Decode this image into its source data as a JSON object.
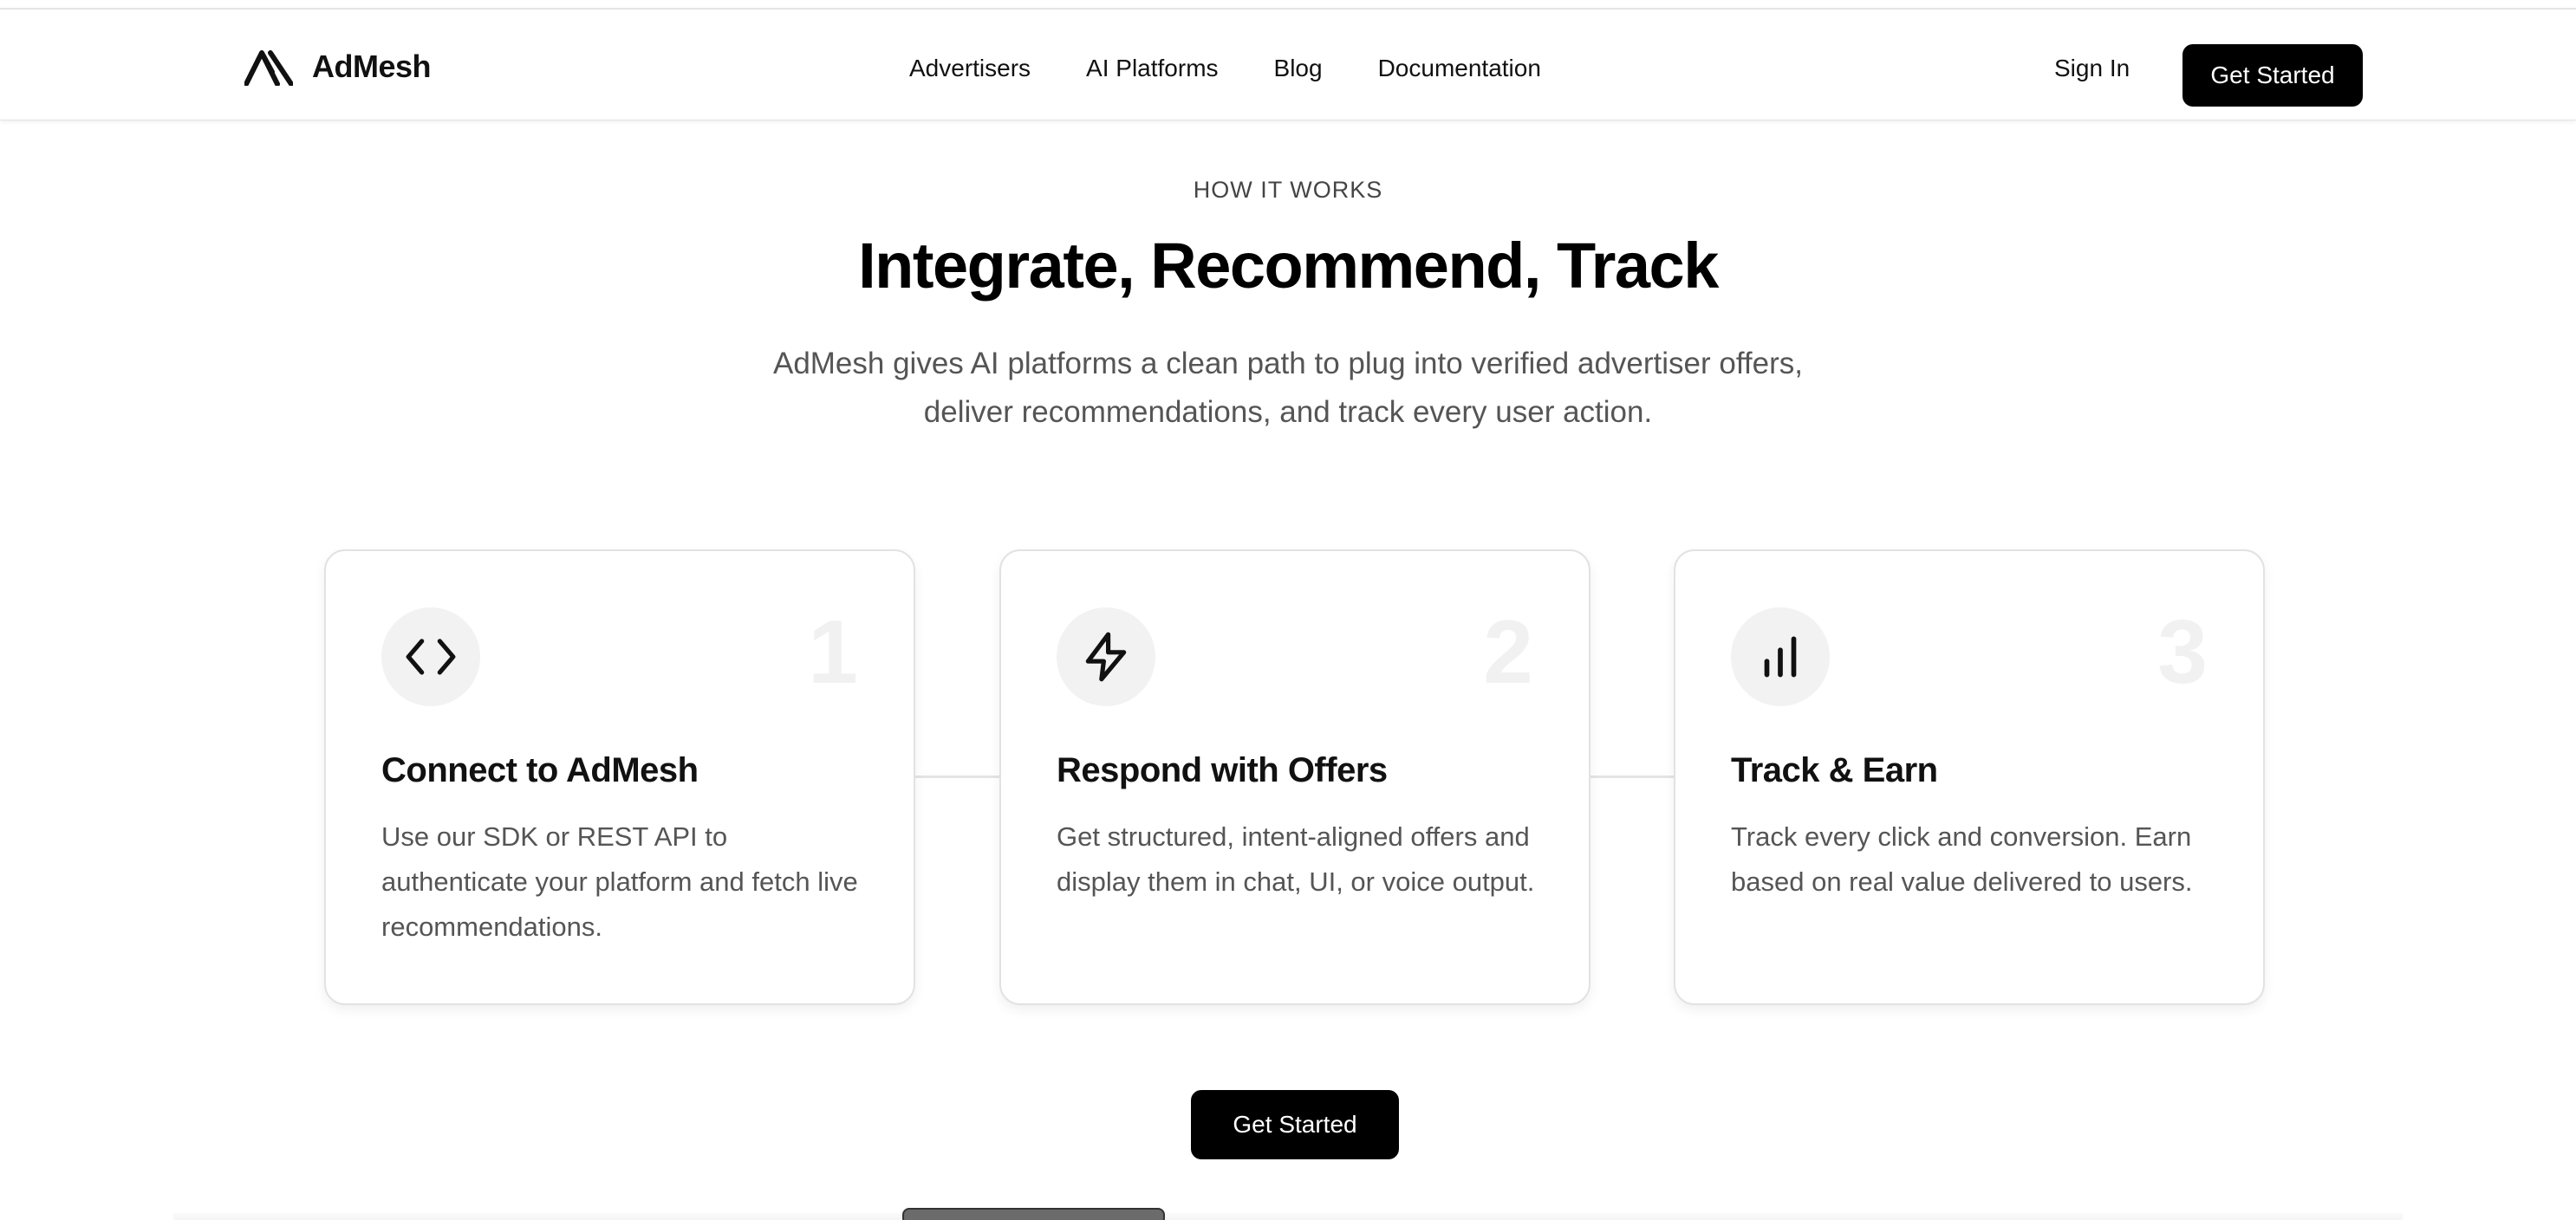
{
  "brand": {
    "name": "AdMesh"
  },
  "nav": {
    "links": [
      "Advertisers",
      "AI Platforms",
      "Blog",
      "Documentation"
    ],
    "sign_in": "Sign In",
    "cta": "Get Started"
  },
  "hero": {
    "eyebrow": "HOW IT WORKS",
    "title": "Integrate, Recommend, Track",
    "subtitle": "AdMesh gives AI platforms a clean path to plug into verified advertiser offers, deliver recommendations, and track every user action."
  },
  "steps": [
    {
      "number": "1",
      "icon": "code-icon",
      "title": "Connect to AdMesh",
      "description": "Use our SDK or REST API to authenticate your platform and fetch live recommendations."
    },
    {
      "number": "2",
      "icon": "lightning-icon",
      "title": "Respond with Offers",
      "description": "Get structured, intent-aligned offers and display them in chat, UI, or voice output."
    },
    {
      "number": "3",
      "icon": "bar-chart-icon",
      "title": "Track & Earn",
      "description": "Track every click and conversion. Earn based on real value delivered to users."
    }
  ],
  "cta": {
    "label": "Get Started"
  },
  "colors": {
    "primary": "#000000",
    "muted_text": "#555555",
    "card_border": "#e2e2e2",
    "icon_bg": "#f2f2f2"
  }
}
